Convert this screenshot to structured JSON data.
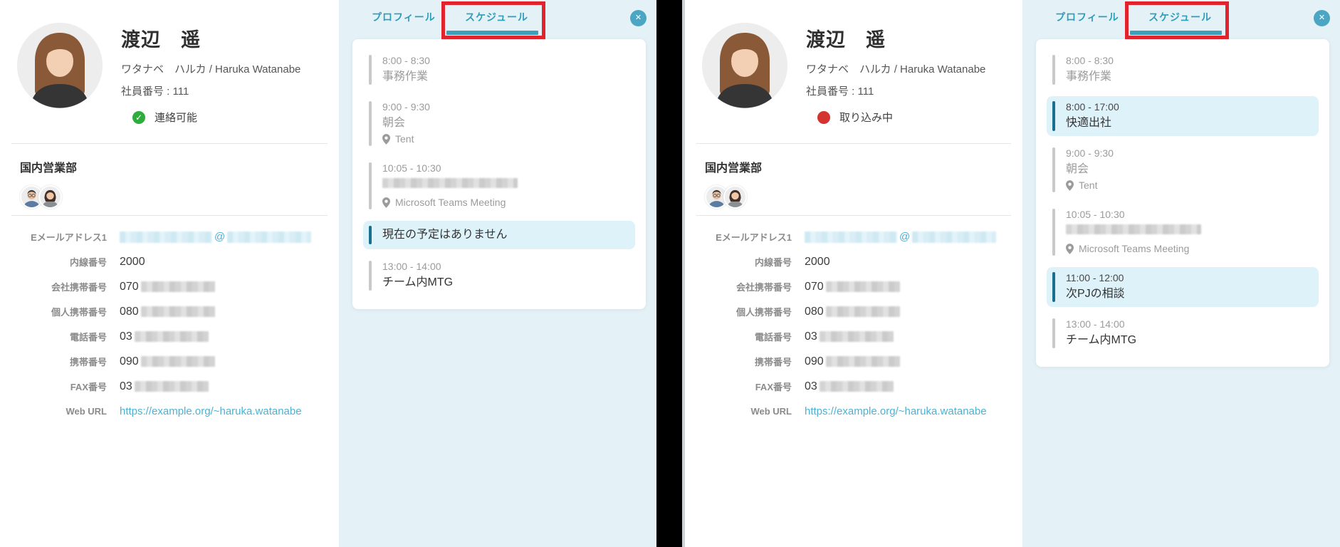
{
  "colors": {
    "accent_teal": "#2f9db8",
    "tab_underline": "#3e9fbc",
    "schedule_bg": "#e4f1f6",
    "highlight_bg": "#def2f9",
    "highlight_bar": "#17708f",
    "inactive_bar": "#c9c9c9",
    "status_available": "#2eac3c",
    "status_busy": "#d4342f",
    "link": "#4cb2d3",
    "annotation_red": "#e0232d"
  },
  "tabs": {
    "profile": "プロフィール",
    "schedule": "スケジュール"
  },
  "icons": {
    "close": "✕",
    "status_check": "✓",
    "email_at": "@",
    "location_pin": "map-pin"
  },
  "panels": [
    {
      "profile": {
        "name": "渡辺　遥",
        "furigana": "ワタナベ　ハルカ / Haruka Watanabe",
        "employee": "社員番号 : 111",
        "department": "国内営業部",
        "fields": [
          {
            "label": "Eメールアドレス1",
            "type": "email_redacted",
            "at": "@"
          },
          {
            "label": "内線番号",
            "value": "2000"
          },
          {
            "label": "会社携帯番号",
            "prefix": "070",
            "redacted": true
          },
          {
            "label": "個人携帯番号",
            "prefix": "080",
            "redacted": true
          },
          {
            "label": "電話番号",
            "prefix": "03",
            "redacted": true
          },
          {
            "label": "携帯番号",
            "prefix": "090",
            "redacted": true
          },
          {
            "label": "FAX番号",
            "prefix": "03",
            "redacted": true
          },
          {
            "label": "Web URL",
            "value": "https://example.org/~haruka.watanabe",
            "link": true
          }
        ]
      },
      "status": {
        "label": "連絡可能",
        "type": "available"
      },
      "schedule_items": [
        {
          "time": "8:00 - 8:30",
          "title": "事務作業",
          "state": "past"
        },
        {
          "time": "9:00 - 9:30",
          "title": "朝会",
          "location": "Tent",
          "state": "past"
        },
        {
          "time": "10:05 - 10:30",
          "title_redacted": true,
          "location": "Microsoft Teams Meeting",
          "state": "past"
        },
        {
          "title": "現在の予定はありません",
          "state": "current"
        },
        {
          "time": "13:00 - 14:00",
          "title": "チーム内MTG",
          "state": "future"
        }
      ]
    },
    {
      "profile": {
        "name": "渡辺　遥",
        "furigana": "ワタナベ　ハルカ / Haruka Watanabe",
        "employee": "社員番号 : 111",
        "department": "国内営業部",
        "fields": [
          {
            "label": "Eメールアドレス1",
            "type": "email_redacted",
            "at": "@"
          },
          {
            "label": "内線番号",
            "value": "2000"
          },
          {
            "label": "会社携帯番号",
            "prefix": "070",
            "redacted": true
          },
          {
            "label": "個人携帯番号",
            "prefix": "080",
            "redacted": true
          },
          {
            "label": "電話番号",
            "prefix": "03",
            "redacted": true
          },
          {
            "label": "携帯番号",
            "prefix": "090",
            "redacted": true
          },
          {
            "label": "FAX番号",
            "prefix": "03",
            "redacted": true
          },
          {
            "label": "Web URL",
            "value": "https://example.org/~haruka.watanabe",
            "link": true
          }
        ]
      },
      "status": {
        "label": "取り込み中",
        "type": "busy"
      },
      "schedule_items": [
        {
          "time": "8:00 - 8:30",
          "title": "事務作業",
          "state": "past"
        },
        {
          "time": "8:00 - 17:00",
          "title": "快適出社",
          "state": "current"
        },
        {
          "time": "9:00 - 9:30",
          "title": "朝会",
          "location": "Tent",
          "state": "past"
        },
        {
          "time": "10:05 - 10:30",
          "title_redacted": true,
          "location": "Microsoft Teams Meeting",
          "state": "past"
        },
        {
          "time": "11:00 - 12:00",
          "title": "次PJの相談",
          "state": "current"
        },
        {
          "time": "13:00 - 14:00",
          "title": "チーム内MTG",
          "state": "future"
        }
      ]
    }
  ]
}
